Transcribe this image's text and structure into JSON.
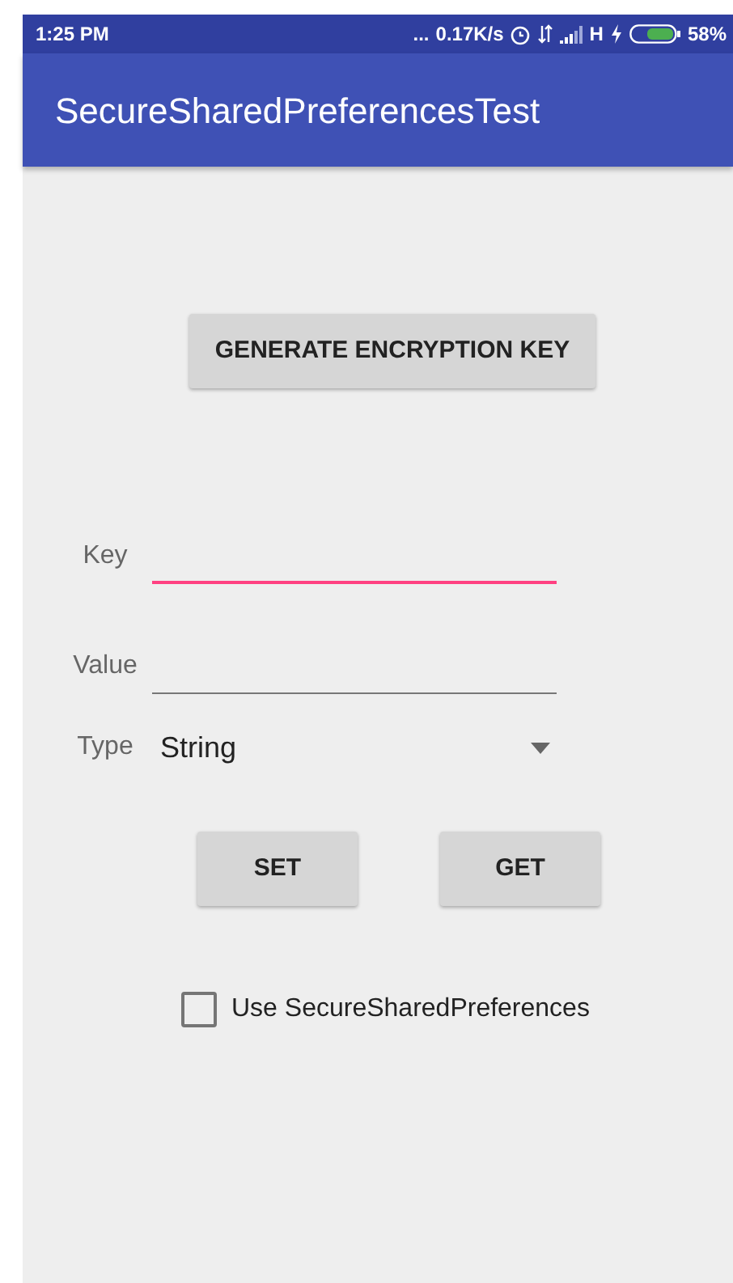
{
  "status_bar": {
    "time": "1:25 PM",
    "more": "...",
    "network_speed": "0.17K/s",
    "network_type": "H",
    "battery": "58%"
  },
  "app_bar": {
    "title": "SecureSharedPreferencesTest"
  },
  "generate_button": "GENERATE ENCRYPTION KEY",
  "fields": [
    {
      "label": "Key",
      "focused": true
    },
    {
      "label": "Value",
      "focused": false
    }
  ],
  "spinner": {
    "label": "Type",
    "value": "String"
  },
  "buttons": [
    "SET",
    "GET"
  ],
  "checkbox": {
    "label": "Use SecureSharedPreferences",
    "checked": false
  }
}
